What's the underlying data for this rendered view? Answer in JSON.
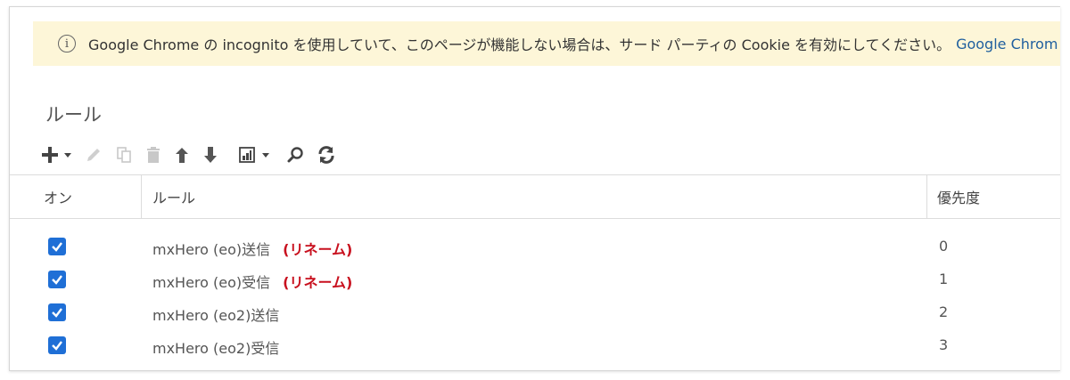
{
  "banner": {
    "icon": "info-circle-icon",
    "text": "Google Chrome の incognito を使用していて、このページが機能しない場合は、サード パーティの Cookie を有効にしてください。",
    "link": "Google Chrom"
  },
  "section": {
    "title": "ルール"
  },
  "toolbar": {
    "items": [
      {
        "icon": "plus-icon",
        "enabled": true
      },
      {
        "icon": "caret-down-icon",
        "enabled": true
      },
      {
        "icon": "pencil-icon",
        "enabled": false
      },
      {
        "icon": "copy-icon",
        "enabled": false
      },
      {
        "icon": "trash-icon",
        "enabled": false
      },
      {
        "icon": "arrow-up-icon",
        "enabled": true
      },
      {
        "icon": "arrow-down-icon",
        "enabled": true
      },
      {
        "icon": "export-icon",
        "enabled": true
      },
      {
        "icon": "search-icon",
        "enabled": true
      },
      {
        "icon": "refresh-icon",
        "enabled": true
      }
    ]
  },
  "table": {
    "columns": [
      "オン",
      "ルール",
      "優先度"
    ],
    "rows": [
      {
        "on": true,
        "name": "mxHero (eo)送信",
        "badge": "(リネーム)",
        "priority": "0"
      },
      {
        "on": true,
        "name": "mxHero (eo)受信",
        "badge": "(リネーム)",
        "priority": "1"
      },
      {
        "on": true,
        "name": "mxHero (eo2)送信",
        "badge": "",
        "priority": "2"
      },
      {
        "on": true,
        "name": "mxHero (eo2)受信",
        "badge": "",
        "priority": "3"
      }
    ]
  },
  "colors": {
    "banner_bg": "#fdf6d8",
    "checkbox": "#1f6fd6",
    "badge": "#c8101e",
    "link": "#1f5f9e"
  }
}
